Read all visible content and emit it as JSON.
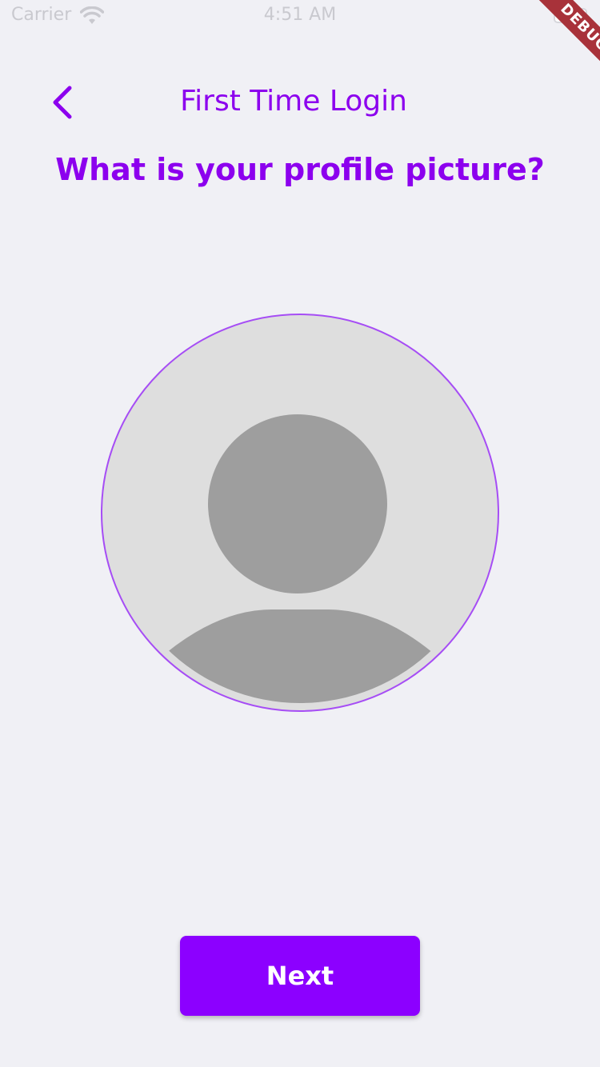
{
  "status_bar": {
    "carrier": "Carrier",
    "time": "4:51 AM",
    "wifi_icon": "wifi-icon",
    "battery_icon": "battery-icon"
  },
  "debug_banner": "DEBUG",
  "header": {
    "back_icon": "chevron-left-icon",
    "title": "First Time Login"
  },
  "question": "What is your profile picture?",
  "avatar": {
    "icon": "person-placeholder-icon"
  },
  "next_button": {
    "label": "Next"
  },
  "colors": {
    "accent": "#8c00ff",
    "background": "#f0f0f5",
    "avatar_bg": "#dedede",
    "avatar_figure": "#9e9e9e"
  }
}
